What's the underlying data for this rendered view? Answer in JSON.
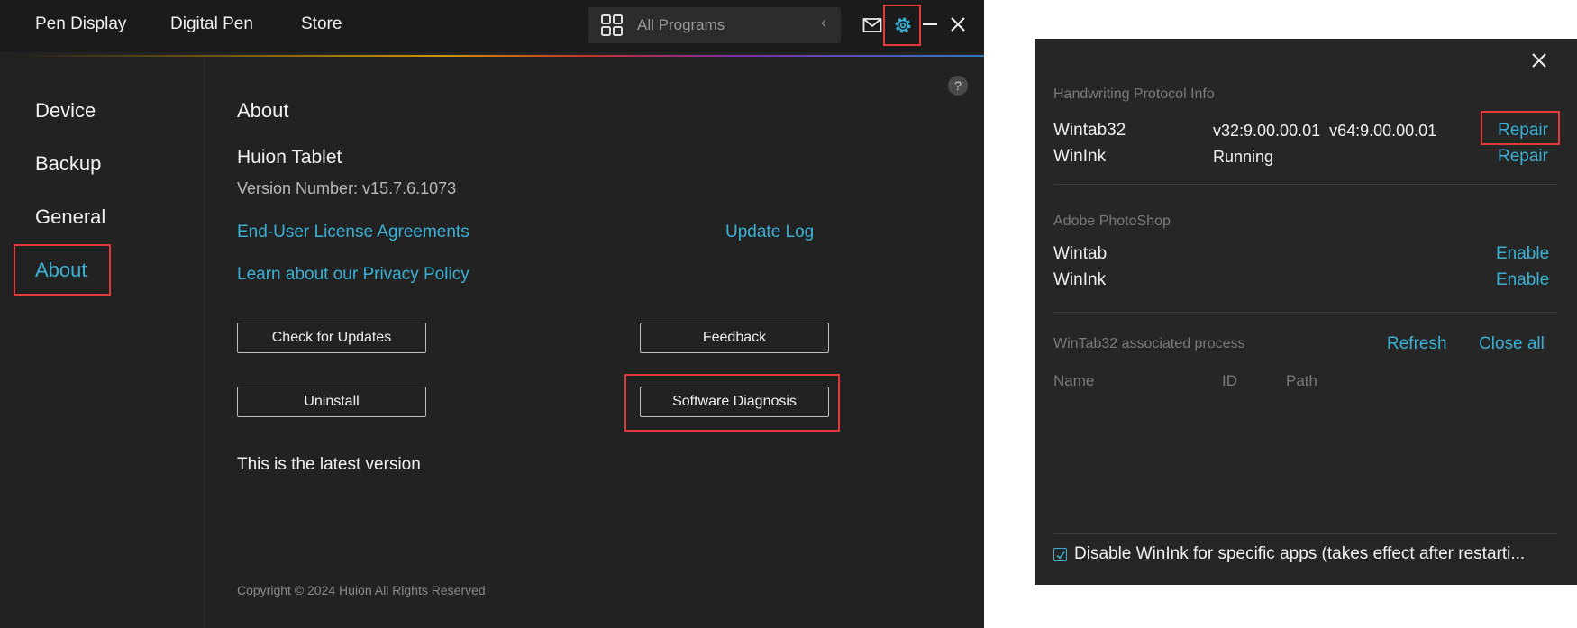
{
  "window": {
    "tabs": [
      "Pen Display",
      "Digital Pen",
      "Store"
    ],
    "program_selector": {
      "placeholder": "All Programs",
      "icon": "grid-icon"
    },
    "icons": [
      "mail-icon",
      "gear-icon",
      "minimize-icon",
      "close-icon"
    ]
  },
  "sidebar": {
    "items": [
      {
        "label": "Device"
      },
      {
        "label": "Backup"
      },
      {
        "label": "General"
      },
      {
        "label": "About",
        "active": true
      }
    ]
  },
  "about": {
    "heading": "About",
    "product": "Huion Tablet",
    "version": "Version Number: v15.7.6.1073",
    "eula_link": "End-User License Agreements",
    "update_log_link": "Update Log",
    "privacy_link": "Learn about our Privacy Policy",
    "check_updates": "Check for Updates",
    "feedback": "Feedback",
    "uninstall": "Uninstall",
    "software_diagnosis": "Software Diagnosis",
    "status": "This is the latest version",
    "copyright": "Copyright © 2024 Huion All Rights Reserved",
    "help": "?"
  },
  "diagnosis": {
    "section_protocol": "Handwriting Protocol Info",
    "protocols": [
      {
        "name": "Wintab32",
        "value": "v32:9.00.00.01  v64:9.00.00.01",
        "action": "Repair"
      },
      {
        "name": "WinInk",
        "value": "Running",
        "action": "Repair"
      }
    ],
    "section_photoshop": "Adobe PhotoShop",
    "photoshop": [
      {
        "name": "Wintab",
        "action": "Enable"
      },
      {
        "name": "WinInk",
        "action": "Enable"
      }
    ],
    "section_process": "WinTab32 associated process",
    "refresh": "Refresh",
    "close_all": "Close all",
    "columns": [
      "Name",
      "ID",
      "Path"
    ],
    "checkbox_label": "Disable WinInk for specific apps (takes effect after restarti...",
    "checkbox_checked": true
  },
  "colors": {
    "accent": "#3ab1d4",
    "highlight": "#e03a3a",
    "background": "#222222"
  }
}
